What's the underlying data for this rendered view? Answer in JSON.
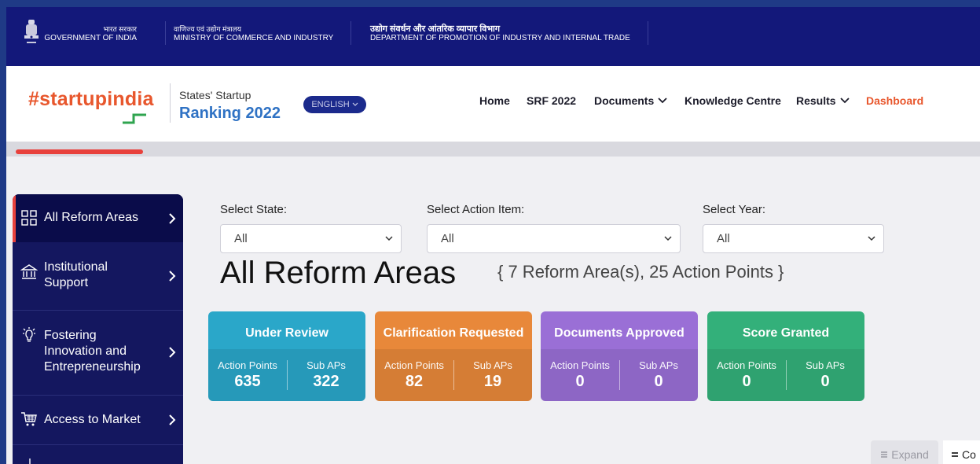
{
  "gov": {
    "gov_hi": "भारत सरकार",
    "gov_en": "GOVERNMENT OF INDIA",
    "ministry_hi": "वाणिज्य एवं उद्योग मंत्रालय",
    "ministry_en": "MINISTRY OF COMMERCE AND INDUSTRY",
    "dept_hi": "उद्योग संवर्धन और आंतरिक व्यापार विभाग",
    "dept_en": "DEPARTMENT OF PROMOTION OF INDUSTRY AND INTERNAL TRADE"
  },
  "header": {
    "logo_text": "#startupindia",
    "brand_sub": "States' Startup",
    "brand_main": "Ranking 2022",
    "language": "ENGLISH",
    "nav": [
      "Home",
      "SRF 2022",
      "Documents",
      "Knowledge Centre",
      "Results",
      "Dashboard"
    ]
  },
  "sidebar": {
    "items": [
      {
        "label": "All Reform Areas",
        "icon": "grid-icon"
      },
      {
        "label": "Institutional Support",
        "icon": "institution-icon"
      },
      {
        "label": "Fostering Innovation and Entrepreneurship",
        "icon": "bulb-icon"
      },
      {
        "label": "Access to Market",
        "icon": "cart-icon"
      }
    ]
  },
  "filters": {
    "state_label": "Select State:",
    "state_value": "All",
    "action_label": "Select Action Item:",
    "action_value": "All",
    "year_label": "Select Year:",
    "year_value": "All"
  },
  "main": {
    "title": "All Reform Areas",
    "subtitle": "{ 7 Reform Area(s), 25 Action Points }"
  },
  "cards": [
    {
      "title": "Under Review",
      "k1": "Action Points",
      "v1": "635",
      "k2": "Sub APs",
      "v2": "322",
      "color": "#2aa7c9"
    },
    {
      "title": "Clarification Requested",
      "k1": "Action Points",
      "v1": "82",
      "k2": "Sub APs",
      "v2": "19",
      "color": "#e8883a"
    },
    {
      "title": "Documents Approved",
      "k1": "Action Points",
      "v1": "0",
      "k2": "Sub APs",
      "v2": "0",
      "color": "#9a6fd6"
    },
    {
      "title": "Score Granted",
      "k1": "Action Points",
      "v1": "0",
      "k2": "Sub APs",
      "v2": "0",
      "color": "#33b07a"
    }
  ],
  "controls": {
    "expand": "Expand",
    "collapse_partial": "Co"
  },
  "colors": {
    "brand_orange": "#e8572d",
    "brand_blue": "#2f72c4",
    "nav_dark": "#14175f"
  }
}
